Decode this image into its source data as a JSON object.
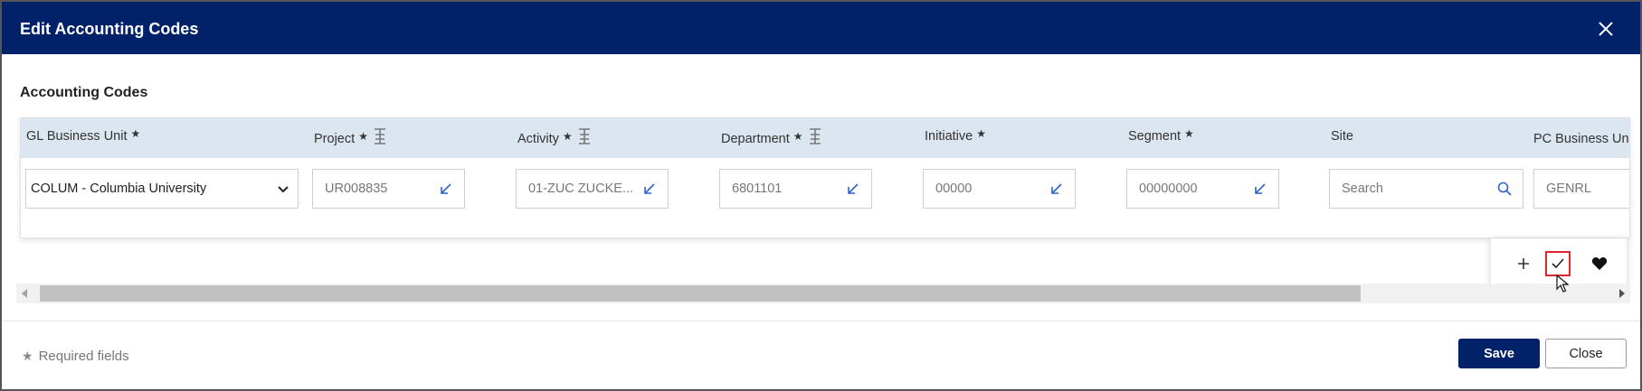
{
  "dialog": {
    "title": "Edit Accounting Codes",
    "section_title": "Accounting Codes"
  },
  "columns": [
    {
      "label": "GL Business Unit",
      "required": "★",
      "value": "COLUM - Columbia University",
      "kind": "select"
    },
    {
      "label": "Project",
      "required": "★",
      "value": "UR008835",
      "kind": "lookup",
      "tree_icon": true
    },
    {
      "label": "Activity",
      "required": "★",
      "value": "01-ZUC ZUCKE...",
      "kind": "lookup",
      "tree_icon": true
    },
    {
      "label": "Department",
      "required": "★",
      "value": "6801101",
      "kind": "lookup",
      "tree_icon": true
    },
    {
      "label": "Initiative",
      "required": "★",
      "value": "00000",
      "kind": "lookup"
    },
    {
      "label": "Segment",
      "required": "★",
      "value": "00000000",
      "kind": "lookup"
    },
    {
      "label": "Site",
      "required": "",
      "placeholder": "Search",
      "kind": "search"
    },
    {
      "label": "PC Business Unit",
      "required": "",
      "value": "GENRL",
      "kind": "text"
    }
  ],
  "row_actions": {
    "add_icon": "plus-icon",
    "confirm_icon": "checkmark-icon",
    "favorite_icon": "heart-icon"
  },
  "footer": {
    "required_note": "Required fields",
    "required_star": "★",
    "save_label": "Save",
    "close_label": "Close"
  },
  "colors": {
    "brand_navy": "#012169",
    "grid_header": "#dbe6f0",
    "lookup_arrow": "#2b63c9",
    "highlight": "#e0262d"
  }
}
